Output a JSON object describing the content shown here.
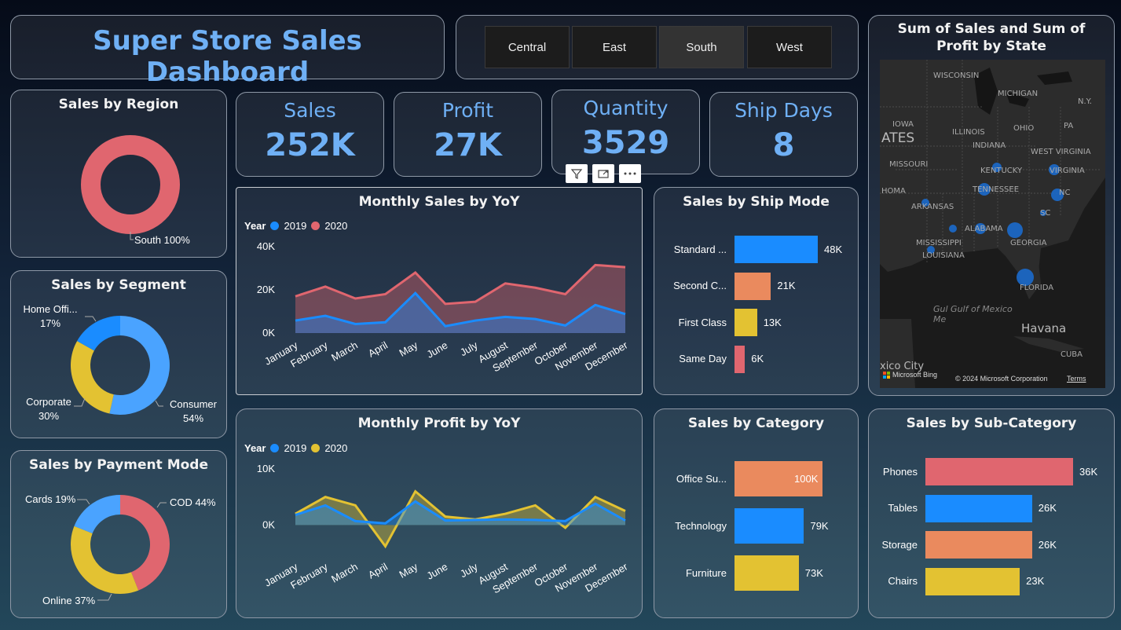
{
  "title": "Super Store Sales Dashboard",
  "slicer": {
    "options": [
      "Central",
      "East",
      "South",
      "West"
    ],
    "selected": "South"
  },
  "kpis": {
    "sales": {
      "label": "Sales",
      "value": "252K"
    },
    "profit": {
      "label": "Profit",
      "value": "27K"
    },
    "quantity": {
      "label": "Quantity",
      "value": "3529"
    },
    "ship_days": {
      "label": "Ship Days",
      "value": "8"
    }
  },
  "colors": {
    "blue": "#1a8cff",
    "red": "#e0666f",
    "orange": "#ea8a5e",
    "yellow": "#e3c232",
    "kpi_text": "#6fb0f5"
  },
  "icons": [
    "filter-icon",
    "focus-mode-icon",
    "more-options-icon",
    "microsoft-logo-icon"
  ],
  "map": {
    "title": "Sum of Sales and Sum of Profit by State",
    "labels": [
      "WISCONSIN",
      "MICHIGAN",
      "IOWA",
      "ILLINOIS",
      "OHIO",
      "PA",
      "N.Y.",
      "INDIANA",
      "ATES",
      "WEST VIRGINIA",
      "MISSOURI",
      "KENTUCKY",
      "VIRGINIA",
      "TENNESSEE",
      "NC",
      "ARKANSAS",
      "SC",
      "HOMA",
      "ALABAMA",
      "GEORGIA",
      "MISSISSIPPI",
      "LOUISIANA",
      "FLORIDA",
      "Gul Gulf of Mexico",
      "Me",
      "Havana",
      "CUBA",
      "xico City"
    ],
    "attribution_brand": "Microsoft Bing",
    "copyright": "© 2024 Microsoft Corporation",
    "terms": "Terms"
  },
  "chart_data": [
    {
      "id": "sales_by_region",
      "type": "pie",
      "title": "Sales by Region",
      "slices": [
        {
          "label": "South",
          "value": 100,
          "display": "South 100%",
          "color": "#e0666f"
        }
      ]
    },
    {
      "id": "sales_by_segment",
      "type": "pie",
      "title": "Sales by Segment",
      "slices": [
        {
          "label": "Consumer",
          "value": 54,
          "display_name": "Consumer",
          "display_pct": "54%",
          "color": "#4aa3ff"
        },
        {
          "label": "Corporate",
          "value": 30,
          "display_name": "Corporate",
          "display_pct": "30%",
          "color": "#e3c232"
        },
        {
          "label": "Home Office",
          "value": 17,
          "display_name": "Home Offi...",
          "display_pct": "17%",
          "color": "#1a8cff"
        }
      ]
    },
    {
      "id": "sales_by_payment_mode",
      "type": "pie",
      "title": "Sales by Payment Mode",
      "slices": [
        {
          "label": "COD",
          "value": 44,
          "display": "COD 44%",
          "color": "#e0666f"
        },
        {
          "label": "Online",
          "value": 37,
          "display": "Online 37%",
          "color": "#e3c232"
        },
        {
          "label": "Cards",
          "value": 19,
          "display": "Cards 19%",
          "color": "#4aa3ff"
        }
      ]
    },
    {
      "id": "monthly_sales_yoy",
      "type": "area",
      "title": "Monthly Sales by YoY",
      "legend_title": "Year",
      "categories": [
        "January",
        "February",
        "March",
        "April",
        "May",
        "June",
        "July",
        "August",
        "September",
        "October",
        "November",
        "December"
      ],
      "series": [
        {
          "name": "2019",
          "color": "#1a8cff",
          "values": [
            5800,
            8000,
            4200,
            5000,
            18500,
            3200,
            5800,
            7500,
            6500,
            3500,
            13000,
            8800
          ]
        },
        {
          "name": "2020",
          "color": "#e0666f",
          "values": [
            17000,
            21500,
            16000,
            18000,
            28000,
            13500,
            14500,
            23000,
            21000,
            18000,
            31500,
            30500
          ]
        }
      ],
      "yticks": [
        "0K",
        "20K",
        "40K"
      ],
      "ylim": [
        0,
        40000
      ]
    },
    {
      "id": "monthly_profit_yoy",
      "type": "area",
      "title": "Monthly Profit by YoY",
      "legend_title": "Year",
      "categories": [
        "January",
        "February",
        "March",
        "April",
        "May",
        "June",
        "July",
        "August",
        "September",
        "October",
        "November",
        "December"
      ],
      "series": [
        {
          "name": "2019",
          "color": "#1a8cff",
          "values": [
            1800,
            3500,
            700,
            300,
            4200,
            800,
            900,
            1000,
            900,
            700,
            3800,
            800
          ]
        },
        {
          "name": "2020",
          "color": "#e3c232",
          "values": [
            2000,
            5000,
            3500,
            -3800,
            6000,
            1500,
            1000,
            2000,
            3500,
            -500,
            5000,
            2500
          ]
        }
      ],
      "yticks": [
        "0K",
        "10K"
      ],
      "ylim": [
        -5000,
        10000
      ]
    },
    {
      "id": "sales_by_ship_mode",
      "type": "bar",
      "title": "Sales by Ship Mode",
      "categories": [
        "Standard ...",
        "Second C...",
        "First Class",
        "Same Day"
      ],
      "values": [
        48,
        21,
        13,
        6
      ],
      "labels": [
        "48K",
        "21K",
        "13K",
        "6K"
      ],
      "colors": [
        "#1a8cff",
        "#ea8a5e",
        "#e3c232",
        "#e0666f"
      ]
    },
    {
      "id": "sales_by_category",
      "type": "bar",
      "title": "Sales by Category",
      "categories": [
        "Office Su...",
        "Technology",
        "Furniture"
      ],
      "values": [
        100,
        79,
        73
      ],
      "labels": [
        "100K",
        "79K",
        "73K"
      ],
      "colors": [
        "#ea8a5e",
        "#1a8cff",
        "#e3c232"
      ]
    },
    {
      "id": "sales_by_subcategory",
      "type": "bar",
      "title": "Sales by Sub-Category",
      "categories": [
        "Phones",
        "Tables",
        "Storage",
        "Chairs"
      ],
      "values": [
        36,
        26,
        26,
        23
      ],
      "labels": [
        "36K",
        "26K",
        "26K",
        "23K"
      ],
      "colors": [
        "#e0666f",
        "#1a8cff",
        "#ea8a5e",
        "#e3c232"
      ]
    }
  ]
}
